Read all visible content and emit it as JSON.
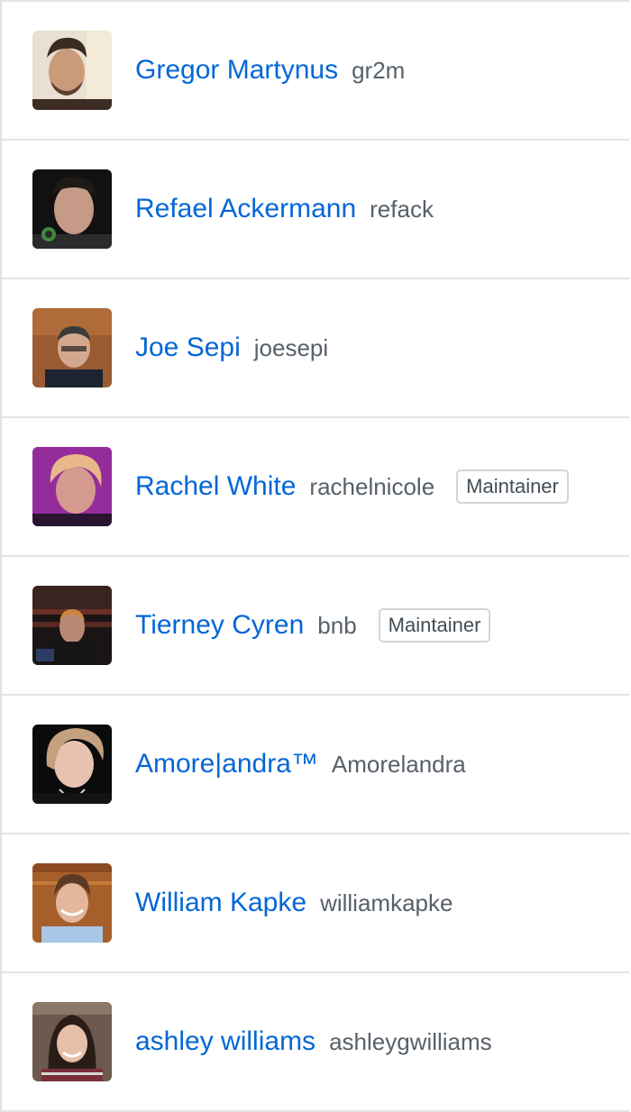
{
  "members": [
    {
      "name": "Gregor Martynus",
      "login": "gr2m",
      "badge": ""
    },
    {
      "name": "Refael Ackermann",
      "login": "refack",
      "badge": ""
    },
    {
      "name": "Joe Sepi",
      "login": "joesepi",
      "badge": ""
    },
    {
      "name": "Rachel White",
      "login": "rachelnicole",
      "badge": "Maintainer"
    },
    {
      "name": "Tierney Cyren",
      "login": "bnb",
      "badge": "Maintainer"
    },
    {
      "name": "Amore|andra™",
      "login": "Amorelandra",
      "badge": ""
    },
    {
      "name": "William Kapke",
      "login": "williamkapke",
      "badge": ""
    },
    {
      "name": "ashley williams",
      "login": "ashleygwilliams",
      "badge": ""
    }
  ],
  "colors": {
    "link": "#0366d6",
    "muted": "#586069",
    "border": "#e1e4e8"
  }
}
